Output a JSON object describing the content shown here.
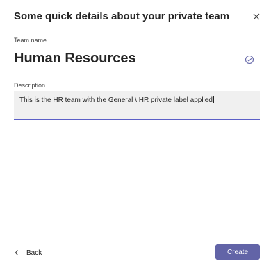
{
  "dialog": {
    "title": "Some quick details about your private team",
    "close_icon": "close-icon"
  },
  "team": {
    "name_label": "Team name",
    "name_value": "Human Resources",
    "status_icon": "check-circle-icon"
  },
  "description": {
    "label": "Description",
    "value": "This is the HR team with the General \\ HR private label applied"
  },
  "footer": {
    "back_label": "Back",
    "back_icon": "chevron-left-icon",
    "create_label": "Create"
  },
  "colors": {
    "accent": "#6264a7",
    "underline": "#5b5fc7",
    "field_bg": "#f0f0f0"
  }
}
